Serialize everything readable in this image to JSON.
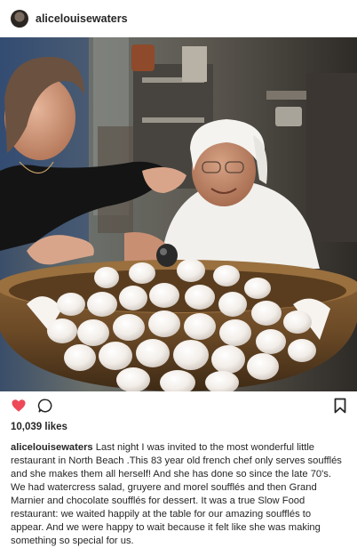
{
  "header": {
    "username": "alicelouisewaters",
    "avatar_icon": "profile-avatar"
  },
  "photo": {
    "alt": "Two women laughing in a restaurant kitchen behind a large wooden bowl of eggs"
  },
  "actions": {
    "like_icon": "heart-filled-icon",
    "comment_icon": "comment-icon",
    "save_icon": "bookmark-icon",
    "like_color": "#ed4956"
  },
  "likes": "10,039 likes",
  "caption": {
    "user": "alicelouisewaters",
    "text": " Last night I was invited to the most wonderful little restaurant in North Beach .This 83 year old french chef only serves soufflés and she makes them all herself! And she has done so since the late 70's. We had watercress salad, gruyere and morel soufflés and then Grand Marnier and chocolate soufflés for dessert. It was a true Slow Food restaurant: we waited happily at the table for our amazing soufflés to appear. And we were happy to wait because it felt like she was making something so special for us."
  }
}
